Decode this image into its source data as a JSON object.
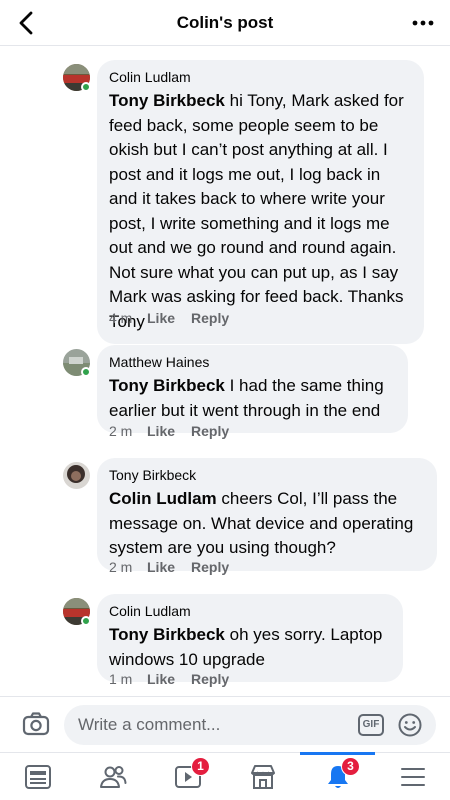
{
  "header": {
    "title": "Colin's post",
    "back_icon": "chevron-left-icon",
    "more_icon": "more-horizontal-icon"
  },
  "comments": [
    {
      "author": "Colin Ludlam",
      "online": true,
      "mention": "Tony Birkbeck",
      "text": " hi Tony, Mark asked for feed back, some people seem to be okish but I can’t post anything at all. I post and it logs me out, I log back in and it takes back to where write your post, I write something and it logs me out and we go round and round again. Not sure what you can put up, as I say Mark was asking for feed back. Thanks Tony",
      "time": "4 m",
      "like": "Like",
      "reply": "Reply"
    },
    {
      "author": "Matthew Haines",
      "online": true,
      "mention": "Tony Birkbeck",
      "text": " I had the same thing earlier but it went through in the end",
      "time": "2 m",
      "like": "Like",
      "reply": "Reply"
    },
    {
      "author": "Tony Birkbeck",
      "online": false,
      "mention": "Colin Ludlam",
      "text": " cheers Col, I’ll pass the message on. What device and operating system are you using though?",
      "time": "2 m",
      "like": "Like",
      "reply": "Reply"
    },
    {
      "author": "Colin Ludlam",
      "online": true,
      "mention": "Tony Birkbeck",
      "text": " oh yes sorry. Laptop windows 10 upgrade",
      "time": "1 m",
      "like": "Like",
      "reply": "Reply"
    }
  ],
  "composer": {
    "placeholder": "Write a comment...",
    "gif_label": "GIF",
    "camera_icon": "camera-icon",
    "emoji_icon": "emoji-icon"
  },
  "tabbar": {
    "active_tab": "notifications",
    "tabs": [
      {
        "name": "news-feed",
        "icon": "news-feed-icon",
        "badge": ""
      },
      {
        "name": "friends",
        "icon": "friends-icon",
        "badge": ""
      },
      {
        "name": "watch",
        "icon": "watch-video-icon",
        "badge": "1"
      },
      {
        "name": "marketplace",
        "icon": "marketplace-icon",
        "badge": ""
      },
      {
        "name": "notifications",
        "icon": "bell-icon",
        "badge": "3"
      },
      {
        "name": "menu",
        "icon": "menu-icon",
        "badge": ""
      }
    ]
  },
  "colors": {
    "accent": "#1877f2",
    "bubble": "#f0f2f5",
    "secondary_text": "#65676b",
    "online": "#31a24c",
    "badge": "#e41e3f"
  }
}
